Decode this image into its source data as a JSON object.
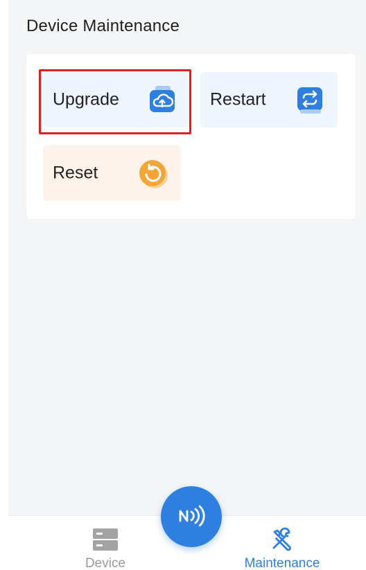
{
  "page": {
    "section_title": "Device Maintenance"
  },
  "actions": [
    {
      "label": "Upgrade",
      "icon": "cloud-upload-icon",
      "tint": "#2f7fe0",
      "bg": "#eef5fc"
    },
    {
      "label": "Restart",
      "icon": "restart-arrows-icon",
      "tint": "#2f7fe0",
      "bg": "#eef5fc"
    },
    {
      "label": "Reset",
      "icon": "reset-circle-icon",
      "tint": "#f2a637",
      "bg": "#fdf3ea"
    }
  ],
  "highlight_color": "#e01e1e",
  "tabbar": {
    "device_label": "Device",
    "maintenance_label": "Maintenance",
    "active_tab": "Maintenance",
    "active_color": "#2f7fe0",
    "inactive_color": "#9a9a9a",
    "fab_icon": "nfc-icon"
  }
}
